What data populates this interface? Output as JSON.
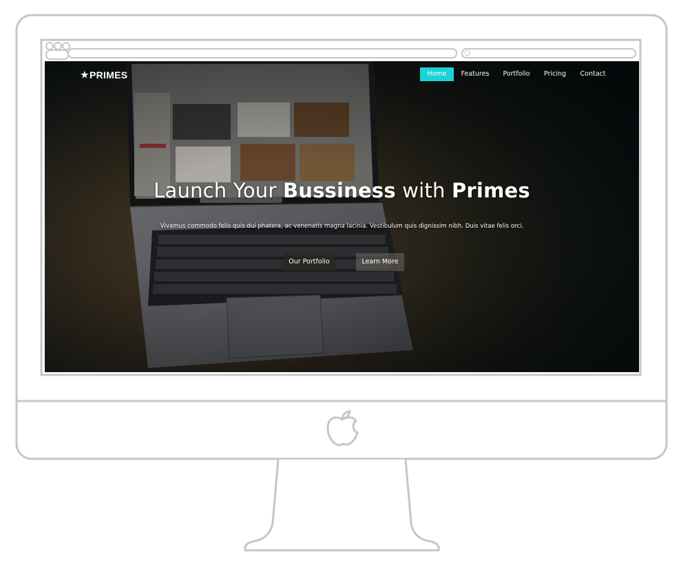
{
  "site": {
    "logo_text": "PRIMES",
    "logo_icon": "star-icon"
  },
  "nav": {
    "items": [
      {
        "label": "Home",
        "active": true
      },
      {
        "label": "Features",
        "active": false
      },
      {
        "label": "Portfolio",
        "active": false
      },
      {
        "label": "Pricing",
        "active": false
      },
      {
        "label": "Contact",
        "active": false
      }
    ]
  },
  "hero": {
    "title_part1": "Launch Your ",
    "title_bold1": "Bussiness",
    "title_part2": " with ",
    "title_bold2": "Primes",
    "text": "Vivamus commodo felis quis dui phatera, ac venenatis magna lacinia. Vestibulum quis dignissim nibh. Duis vitae felis orci.",
    "buttons": {
      "portfolio": "Our Portfolio",
      "learn_more": "Learn More"
    }
  },
  "colors": {
    "accent": "#19d3d9",
    "frame": "#c6c6c6"
  },
  "icons": {
    "monitor_logo": "apple-logo-icon"
  }
}
